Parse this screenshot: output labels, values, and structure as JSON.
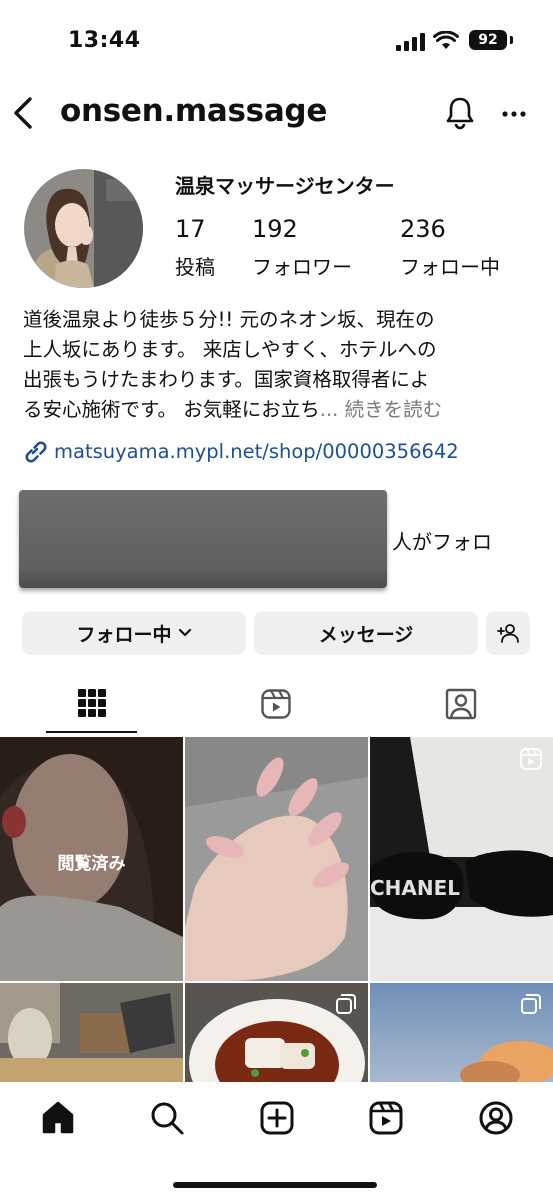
{
  "status_bar": {
    "time": "13:44",
    "battery": "92"
  },
  "header": {
    "username": "onsen.massage"
  },
  "profile": {
    "display_name": "温泉マッサージセンター",
    "stats": [
      {
        "value": "17",
        "label": "投稿"
      },
      {
        "value": "192",
        "label": "フォロワー"
      },
      {
        "value": "236",
        "label": "フォロー中"
      }
    ],
    "bio_lines": [
      "道後温泉より徒歩５分!! 元のネオン坂、現在の",
      "上人坂にあります。 来店しやすく、ホテルへの",
      "出張もうけたまわります。国家資格取得者によ",
      "る安心施術です。 お気軽にお立ち"
    ],
    "bio_ellipsis": "...",
    "bio_more": "続きを読む",
    "link": "matsuyama.mypl.net/shop/00000356642",
    "followed_by_text": "人がフォロ"
  },
  "actions": {
    "following_label": "フォロー中",
    "message_label": "メッセージ"
  },
  "tabs": [
    "grid-icon",
    "reels-icon",
    "tagged-icon"
  ],
  "grid": {
    "seen_label": "閲覧済み",
    "chanel_text": "CHANEL"
  },
  "bottom_nav": [
    "home-icon",
    "search-icon",
    "create-icon",
    "reels-icon",
    "profile-icon"
  ],
  "colors": {
    "link": "#1f4f98",
    "button_bg": "#efefef",
    "muted": "#7a7a7a"
  }
}
